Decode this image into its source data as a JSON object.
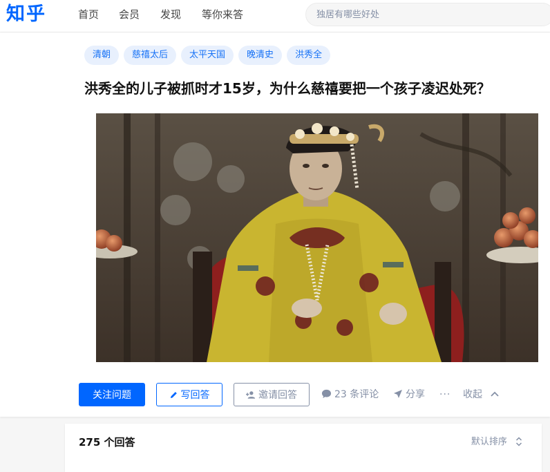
{
  "header": {
    "logo": "知乎",
    "nav": [
      "首页",
      "会员",
      "发现",
      "等你来答"
    ],
    "search_placeholder": "独居有哪些好处"
  },
  "question": {
    "topics": [
      "清朝",
      "慈禧太后",
      "太平天国",
      "晚清史",
      "洪秀全"
    ],
    "title": "洪秀全的儿子被抓时才15岁，为什么慈禧要把一个孩子凌迟处死？",
    "image_alt": "慈禧太后"
  },
  "actions": {
    "follow": "关注问题",
    "write_answer": "写回答",
    "invite": "邀请回答",
    "comments": "23 条评论",
    "share": "分享",
    "more": "···",
    "collapse": "收起"
  },
  "answers": {
    "count_label": "275 个回答",
    "sort_label": "默认排序"
  },
  "colors": {
    "brand": "#0066ff",
    "tag_bg": "#e8f0fd",
    "tag_text": "#1772f6",
    "muted": "#8590a6"
  }
}
